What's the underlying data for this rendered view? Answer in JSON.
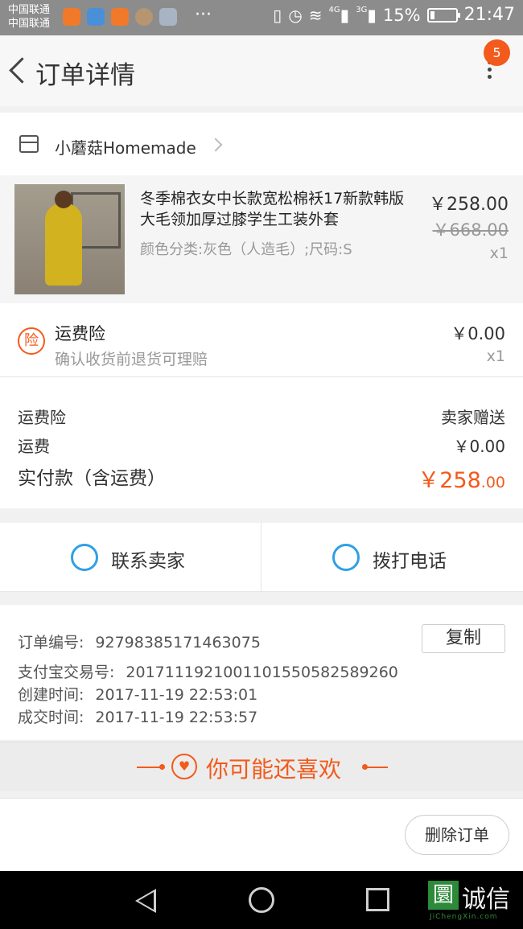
{
  "status_bar": {
    "carrier1": "中国联通",
    "carrier2": "中国联通",
    "net1": "4G",
    "net2": "3G",
    "battery": "15%",
    "battery_level": 0.15,
    "time": "21:47"
  },
  "nav": {
    "title": "订单详情",
    "badge_count": "5"
  },
  "shop": {
    "name": "小蘑菇Homemade"
  },
  "product": {
    "title": "冬季棉衣女中长款宽松棉袄17新款韩版大毛领加厚过膝学生工装外套",
    "spec": "颜色分类:灰色（人造毛）;尺码:S",
    "price": "￥258.00",
    "original_price": "￥668.00",
    "qty": "x1"
  },
  "insurance": {
    "icon_text": "险",
    "title": "运费险",
    "subtitle": "确认收货前退货可理赔",
    "price": "￥0.00",
    "qty": "x1"
  },
  "totals": {
    "insurance_label": "运费险",
    "insurance_value": "卖家赠送",
    "shipping_label": "运费",
    "shipping_value": "￥0.00",
    "paid_label": "实付款（含运费）",
    "paid_main": "￥258",
    "paid_cents": ".00"
  },
  "contact": {
    "seller_label": "联系卖家",
    "call_label": "拨打电话"
  },
  "order_info": {
    "order_no_label": "订单编号:",
    "order_no": "92798385171463075",
    "copy_label": "复制",
    "alipay_label": "支付宝交易号:",
    "alipay_no": "2017111921001101550582589260",
    "created_label": "创建时间:",
    "created": "2017-11-19 22:53:01",
    "completed_label": "成交时间:",
    "completed": "2017-11-19 22:53:57"
  },
  "recommend": {
    "title": "你可能还喜欢"
  },
  "actions": {
    "delete_label": "删除订单"
  },
  "watermark": {
    "cn": "诚信",
    "sub": "JiChengXin.com"
  },
  "colors": {
    "accent": "#f35a1b",
    "contact_blue": "#2fa0e6"
  }
}
